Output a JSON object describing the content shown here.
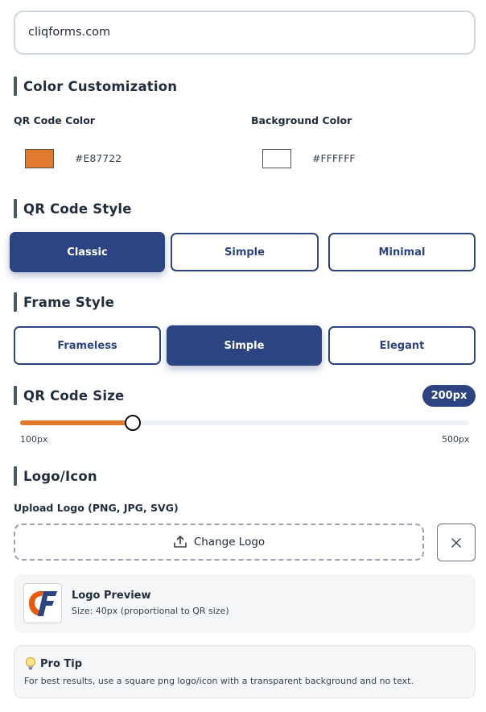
{
  "url_input": {
    "value": "cliqforms.com"
  },
  "color_section": {
    "title": "Color Customization",
    "qr_color_label": "QR Code Color",
    "qr_color_hex": "#E87722",
    "bg_color_label": "Background Color",
    "bg_color_hex": "#FFFFFF"
  },
  "qr_style": {
    "title": "QR Code Style",
    "options": [
      "Classic",
      "Simple",
      "Minimal"
    ],
    "selected": "Classic"
  },
  "frame_style": {
    "title": "Frame Style",
    "options": [
      "Frameless",
      "Simple",
      "Elegant"
    ],
    "selected": "Simple"
  },
  "qr_size": {
    "title": "QR Code Size",
    "badge": "200px",
    "min_label": "100px",
    "max_label": "500px",
    "value": 200,
    "min": 100,
    "max": 500
  },
  "logo": {
    "title": "Logo/Icon",
    "upload_label": "Upload Logo (PNG, JPG, SVG)",
    "change_button": "Change Logo",
    "preview_title": "Logo Preview",
    "preview_size": "Size: 40px (proportional to QR size)"
  },
  "tip": {
    "title": "Pro Tip",
    "text": "For best results, use a square png logo/icon with a transparent background and no text."
  },
  "colors": {
    "accent": "#2C4482",
    "slider_fill": "#E07A2E"
  }
}
